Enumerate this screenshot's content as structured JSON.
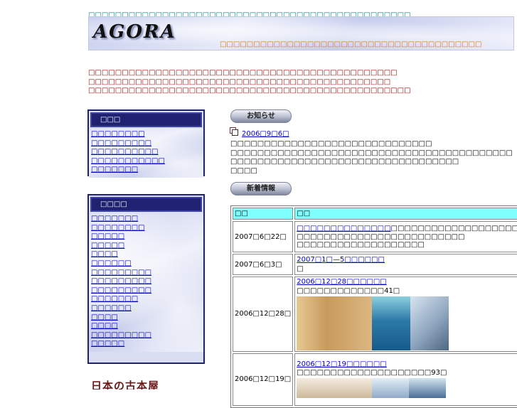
{
  "header": {
    "tagline": "□□□□□□□□□□□□□□□□□□□□□□□□□□□□□□□□□□□□□□□□□□□□□□□□",
    "logo": "AGORA",
    "banner_sub": "□□□□□□□□□□□□□□□□□□□□□□□□□□□□□□□□□□□□□□□"
  },
  "intro": [
    "□□□□□□□□□□□□□□□□□□□□□□□□□□□□□□□□□□□□□□□□□□□□□□",
    "□□□□□□□□□□□□□□□□□□□□□□□□□□□□□□□□□□□□□□□□□□□□□",
    "□□□□□□□□□□□□□□□□□□□□□□□□□□□□□□□□□□□□□□□□□□□□□□□□"
  ],
  "sidebar1": {
    "title": "□□□",
    "links": [
      "□□□□□□□□",
      "□□□□□□□□□",
      "□□□□□□□□□□",
      "□□□□□□□□□□□",
      "□□□□□□□"
    ]
  },
  "sidebar2": {
    "title": "□□□□",
    "links": [
      "□□□□□□□",
      "□□□□□□□□",
      "□□□□□",
      "□□□□□",
      "□□□□",
      "□□□□□□",
      "□□□□□□□□□",
      "□□□□□□□□□",
      "□□□□□□□□□",
      "□□□□□□□",
      "□□□□□□",
      "□□□□",
      "□□□□",
      "□□□□□□□□□",
      "□□□□□"
    ]
  },
  "bookstore_logo": "日本の古本屋",
  "notice": {
    "heading": "お知らせ",
    "date": "2006□9□6□",
    "lines": [
      "□□□□□□□□□□□□□□□□□□□□□□□□□□□□□□",
      "□□□□□□□□□□□□□□□□□□□□□□□□□□□□□□□□□□□□□□□□□□",
      "□□□□□□□□□□□□□□□□□□□□□□□□□□□□□□□□□□",
      "□□□□"
    ]
  },
  "news": {
    "heading": "新着情報",
    "col_date": "□□",
    "col_content": "□□",
    "rows": [
      {
        "date": "2007□6□22□",
        "link": "□□□□□□□□□□□□□□",
        "text1": "□□□□□□□□□□□□□□□□□□□□□□",
        "text2": "□□□□□□□□□□□□□□□□□□□□□□□□□",
        "text3": "□□□□□□□□□□□□□□□□□□□"
      },
      {
        "date": "2007□6□3□",
        "link": "2007□1□—5□□□□□□",
        "text1": "□"
      },
      {
        "date": "2006□12□28□",
        "link": "2006□12□28□□□□□□",
        "text1": "□□□□□□□□□□□□□41□"
      },
      {
        "date": "2006□12□19□",
        "link": "2006□12□19□□□□□□",
        "text1": "□□□□□□□□□□□□□□□□□□□□93□"
      }
    ]
  }
}
